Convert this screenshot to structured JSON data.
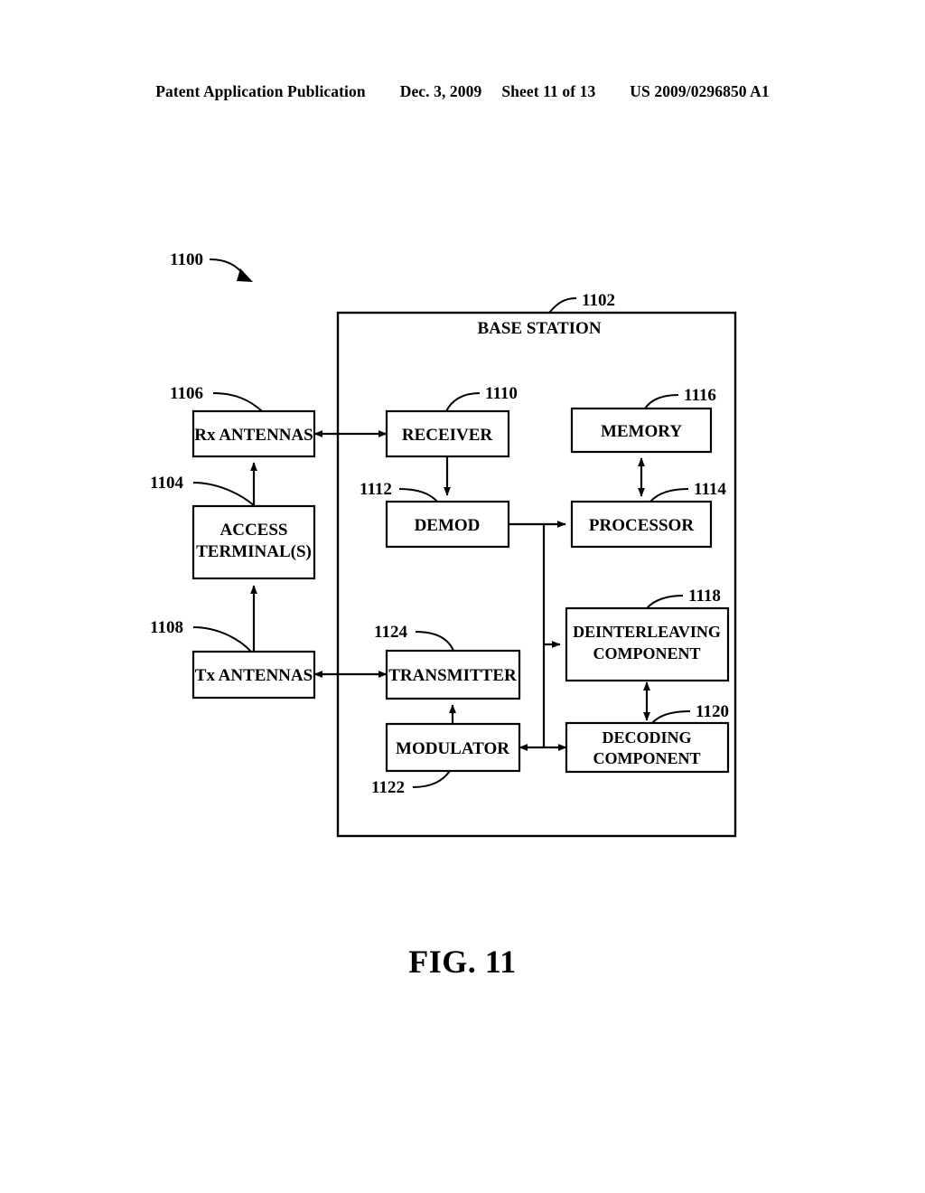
{
  "header": {
    "publication": "Patent Application Publication",
    "date": "Dec. 3, 2009",
    "sheet": "Sheet 11 of 13",
    "patent_number": "US 2009/0296850 A1"
  },
  "figure": {
    "caption": "FIG. 11",
    "diagram_ref": "1100",
    "container_label": "BASE STATION",
    "container_ref": "1102"
  },
  "blocks": {
    "rx_antennas": {
      "label": "Rx ANTENNAS",
      "ref": "1106"
    },
    "access_terminals": {
      "label_line1": "ACCESS",
      "label_line2": "TERMINAL(S)",
      "ref": "1104"
    },
    "tx_antennas": {
      "label": "Tx ANTENNAS",
      "ref": "1108"
    },
    "receiver": {
      "label": "RECEIVER",
      "ref": "1110"
    },
    "demod": {
      "label": "DEMOD",
      "ref": "1112"
    },
    "transmitter": {
      "label": "TRANSMITTER",
      "ref": "1124"
    },
    "modulator": {
      "label": "MODULATOR",
      "ref": "1122"
    },
    "memory": {
      "label": "MEMORY",
      "ref": "1116"
    },
    "processor": {
      "label": "PROCESSOR",
      "ref": "1114"
    },
    "deinterleaving": {
      "label_line1": "DEINTERLEAVING",
      "label_line2": "COMPONENT",
      "ref": "1118"
    },
    "decoding": {
      "label_line1": "DECODING",
      "label_line2": "COMPONENT",
      "ref": "1120"
    }
  },
  "colors": {
    "ink": "#000000",
    "paper": "#ffffff"
  }
}
